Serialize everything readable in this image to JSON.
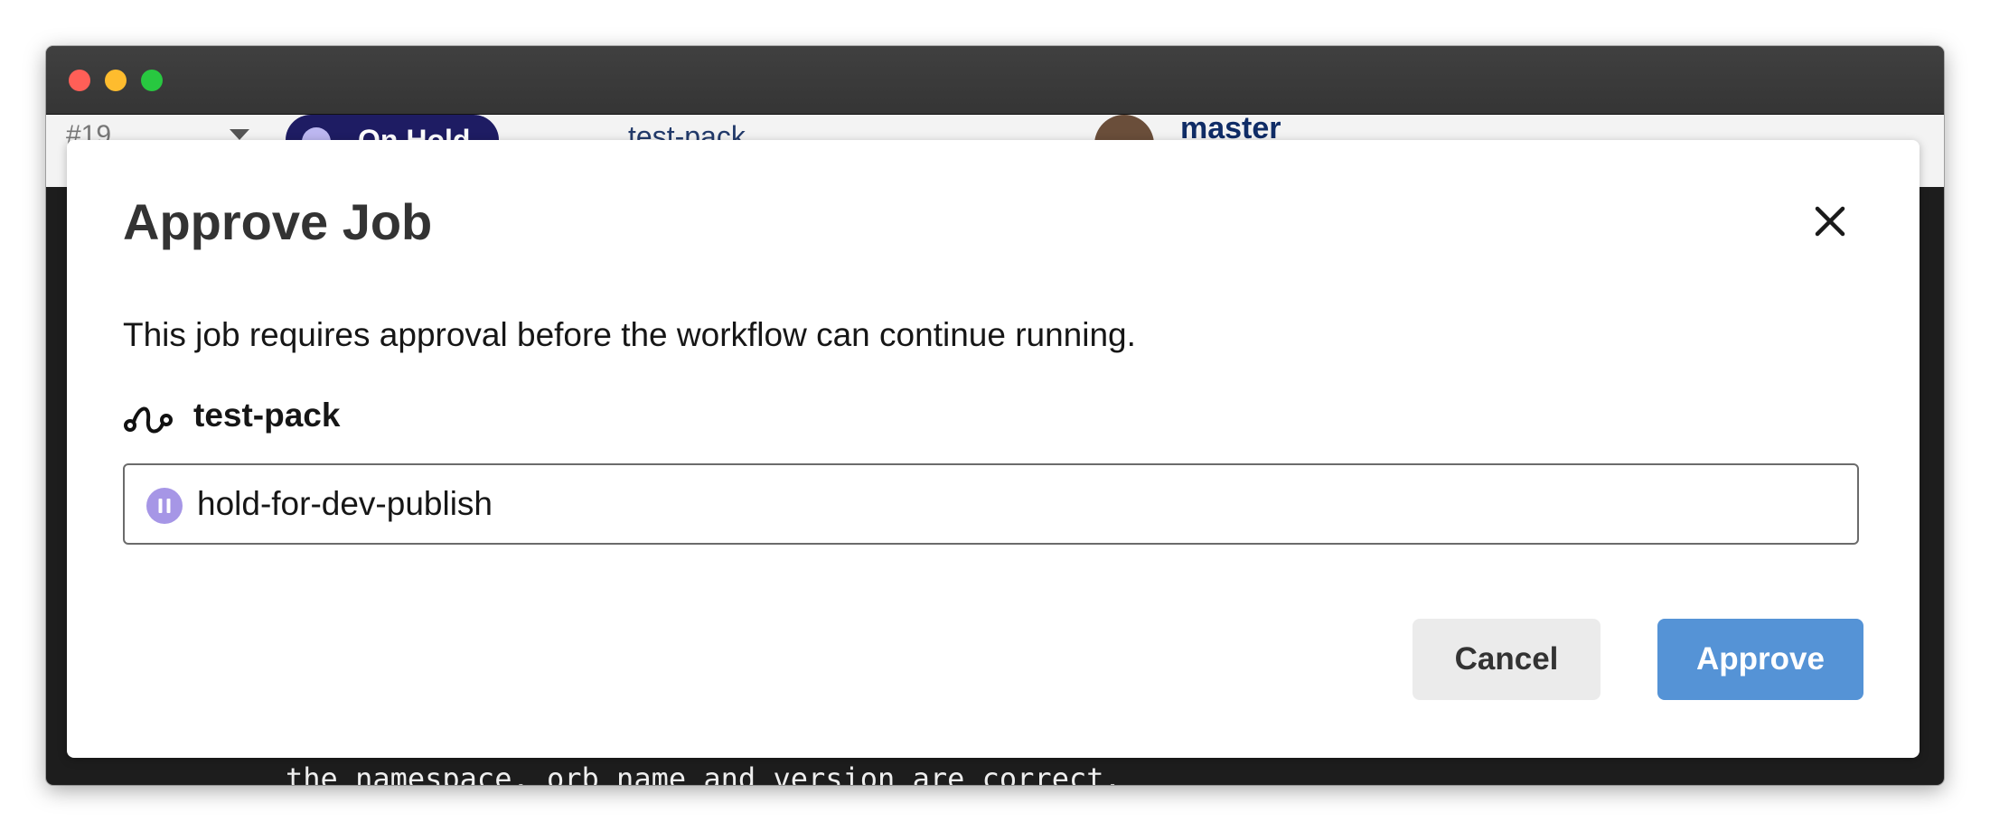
{
  "window": {
    "controls": {
      "close_color": "#ff5f57",
      "minimize_color": "#febc2e",
      "zoom_color": "#28c840"
    }
  },
  "background": {
    "run_number": "#19",
    "status_label": "On Hold",
    "job_name": "test-pack",
    "branch": "master",
    "code_line": "the namespace, orb name and version are correct."
  },
  "modal": {
    "title": "Approve Job",
    "description": "This job requires approval before the workflow can continue running.",
    "job": {
      "icon": "workflow-icon",
      "name": "test-pack"
    },
    "hold_job": {
      "icon": "pause-circle-icon",
      "name": "hold-for-dev-publish",
      "icon_color": "#a696e6"
    },
    "close_icon": "close-icon",
    "buttons": {
      "cancel": "Cancel",
      "approve": "Approve"
    },
    "colors": {
      "approve": "#5593d6",
      "cancel": "#ebebeb",
      "hold_status": "#1e1c63"
    }
  }
}
